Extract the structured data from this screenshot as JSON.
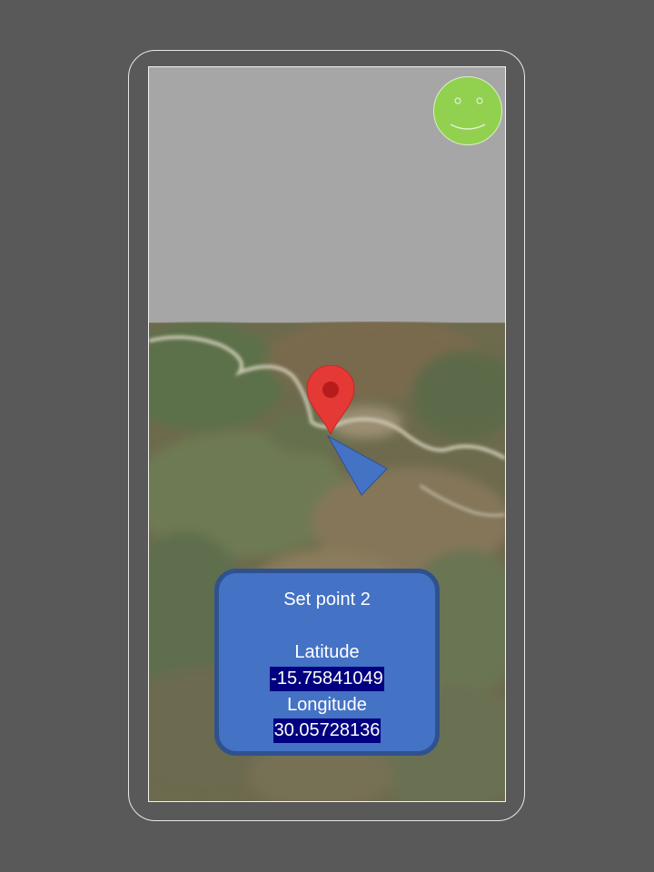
{
  "card": {
    "title": "Set point 2",
    "latitude_label": "Latitude",
    "latitude_value": "-15.75841049",
    "longitude_label": "Longitude",
    "longitude_value": "30.05728136"
  },
  "icons": {
    "avatar": "smiley-face-icon",
    "pin": "map-pin-icon",
    "heading": "direction-arrow-icon"
  },
  "colors": {
    "background": "#595959",
    "top_panel": "#a6a6a6",
    "avatar": "#92d050",
    "card": "#4472c4",
    "card_border": "#2f528f",
    "value_highlight": "#000080",
    "pin": "#e53935",
    "heading_arrow": "#4472c4"
  }
}
